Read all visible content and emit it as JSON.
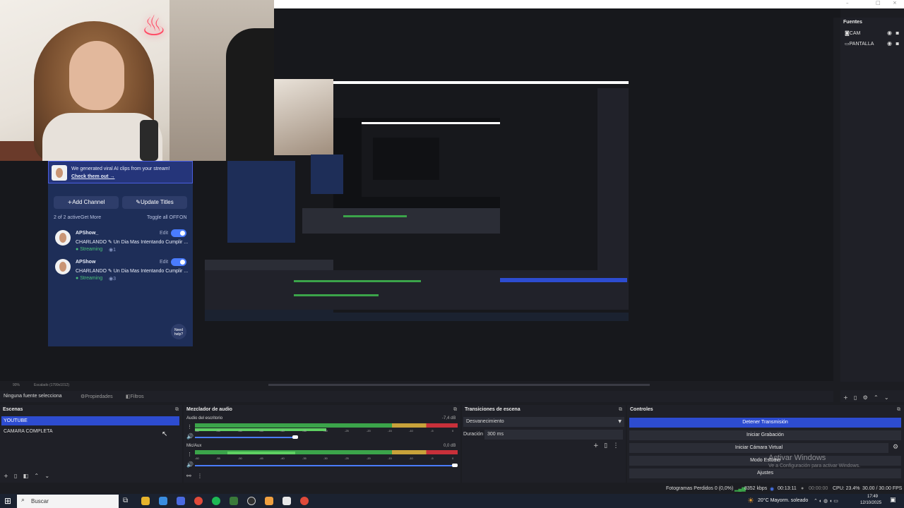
{
  "window": {
    "minimize": "–",
    "maximize": "□",
    "close": "×"
  },
  "multistream_panel": {
    "banner_title": "AI Clips",
    "banner_text": "We generated viral AI clips from your stream!",
    "banner_link": "Check them out →",
    "add_channel": "Add Channel",
    "update_titles": "Update Titles",
    "active_count": "2 of 2 active",
    "get_more": "Get More",
    "toggle_all_off": "Toggle all OFF",
    "toggle_all_on": "ON",
    "edit_label": "Edit",
    "need_help": "Need help?",
    "channels": [
      {
        "name": "APShow_",
        "title": "CHARLANDO ✎ Un Dia Mas Intentando Cumplir ...",
        "status": "Streaming",
        "viewers": "1"
      },
      {
        "name": "APShow",
        "title": "CHARLANDO ✎ Un Dia Mas Intentando Cumplir ...",
        "status": "Streaming",
        "viewers": "3"
      }
    ]
  },
  "sources": {
    "title": "Fuentes",
    "items": [
      {
        "label": "CAM",
        "icon": "camera-icon"
      },
      {
        "label": "PANTALLA",
        "icon": "monitor-icon"
      }
    ]
  },
  "preview_status": {
    "zoom": "90%",
    "scale": "Escalado (1799x1012)"
  },
  "source_toolbar": {
    "no_source": "Ninguna fuente selecciona",
    "properties": "Propiedades",
    "filters": "Filtros"
  },
  "scenes": {
    "title": "Escenas",
    "items": [
      "YOUTUBE",
      "CAMARA COMPLETA"
    ],
    "selected": 0
  },
  "mixer": {
    "title": "Mezclador de audio",
    "ticks": [
      "-60",
      "-55",
      "-50",
      "-45",
      "-40",
      "-35",
      "-30",
      "-25",
      "-20",
      "-15",
      "-10",
      "-5",
      "0"
    ],
    "channels": [
      {
        "name": "Audio del escritorio",
        "db": "-7,4 dB",
        "level": 0.38
      },
      {
        "name": "Mic/Aux",
        "db": "0,0 dB",
        "level": 1.0
      }
    ]
  },
  "transitions": {
    "title": "Transiciones de escena",
    "selected": "Desvanecimiento",
    "duration_label": "Duración",
    "duration_value": "300 ms"
  },
  "controls": {
    "title": "Controles",
    "buttons": [
      "Detener Transmisión",
      "Iniciar Grabación",
      "Iniciar Cámara Virtual",
      "Modo Estudio",
      "Ajustes"
    ],
    "activate_windows_title": "Activar Windows",
    "activate_windows_text": "Ve a Configuración para activar Windows."
  },
  "status_bar": {
    "dropped_frames": "Fotogramas Perdidos 0 (0,0%)",
    "bitrate": "8352 kbps",
    "stream_time": "00:13:11",
    "rec_time": "00:00:00",
    "cpu": "CPU: 23.4%",
    "fps": "30.00 / 30.00 FPS"
  },
  "taskbar": {
    "search_placeholder": "Buscar",
    "weather": "20°C  Mayorm. soleado",
    "time": "17:49",
    "date": "12/10/2025"
  }
}
